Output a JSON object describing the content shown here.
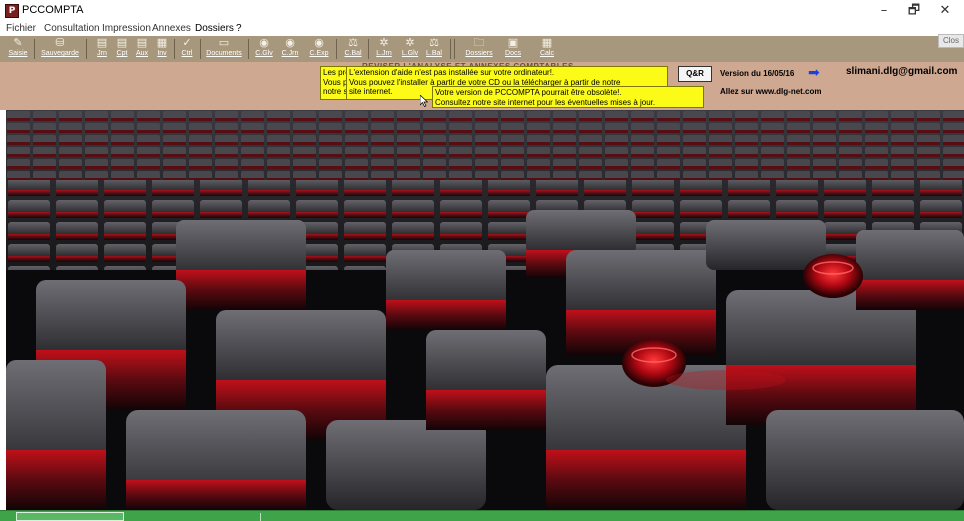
{
  "app": {
    "title": "PCCOMPTA",
    "icon": "app-logo-icon"
  },
  "window_controls": {
    "minimize": "–",
    "maximize": "🗗",
    "close": "✕"
  },
  "menu": [
    {
      "label": "Fichier"
    },
    {
      "label": "Consultation"
    },
    {
      "label": "Impression"
    },
    {
      "label": "Annexes"
    },
    {
      "label": "Dossiers"
    },
    {
      "label": "?"
    }
  ],
  "toolbar": [
    {
      "label": "Saisie",
      "icon": "edit-icon"
    },
    {
      "label": "Sauvegarde",
      "icon": "save-icon"
    },
    {
      "label": "Jrn",
      "icon": "journal-icon"
    },
    {
      "label": "Cpt",
      "icon": "accounts-icon"
    },
    {
      "label": "Aux",
      "icon": "auxiliary-icon"
    },
    {
      "label": "Inv",
      "icon": "inventory-icon"
    },
    {
      "label": "Ctrl",
      "icon": "control-icon"
    },
    {
      "label": "Documents",
      "icon": "documents-icon"
    },
    {
      "label": "C.Glv",
      "icon": "ledger-icon"
    },
    {
      "label": "C.Jrn",
      "icon": "journal-closing-icon"
    },
    {
      "label": "C.Exp",
      "icon": "export-icon"
    },
    {
      "label": "C.Bal",
      "icon": "balance-icon"
    },
    {
      "label": "L.Jrn",
      "icon": "journal-list-icon"
    },
    {
      "label": "L.Glv",
      "icon": "ledger-list-icon"
    },
    {
      "label": "L.Bal",
      "icon": "balance-list-icon"
    },
    {
      "label": "Dossiers",
      "icon": "folder-icon"
    },
    {
      "label": "Docs",
      "icon": "docs-icon"
    },
    {
      "label": "Calc",
      "icon": "calculator-icon"
    }
  ],
  "close_button": "Clos",
  "panel_header": "REVISER L'ANALYSE ET ANNEXES COMPTABLES",
  "tooltips": {
    "left_lines": [
      "Les pré",
      "Vous p",
      "notre s"
    ],
    "help_lines": [
      "L'extension d'aide n'est pas installée sur votre ordinateur!.",
      "Vous pouvez l'installer à partir de votre CD ou la télécharger à partir de notre",
      "site internet."
    ],
    "version_lines": [
      "Votre version de PCCOMPTA pourrait être obsolète!.",
      "Consultez notre site internet pour les éventuelles mises à jour."
    ]
  },
  "qa_button": "Q&R",
  "version_text": "Version du 16/05/16",
  "version_arrow_icon": "arrow-right-icon",
  "email": "slimani.dlg@gmail.com",
  "website_text": "Allez sur  www.dlg-net.com",
  "colors": {
    "toolbar_bg": "#a7987d",
    "panel_bg": "#cfa892",
    "tooltip_bg": "#fbfb17",
    "status_bg": "#3fa34a",
    "wallpaper_red": "#d0101a"
  }
}
